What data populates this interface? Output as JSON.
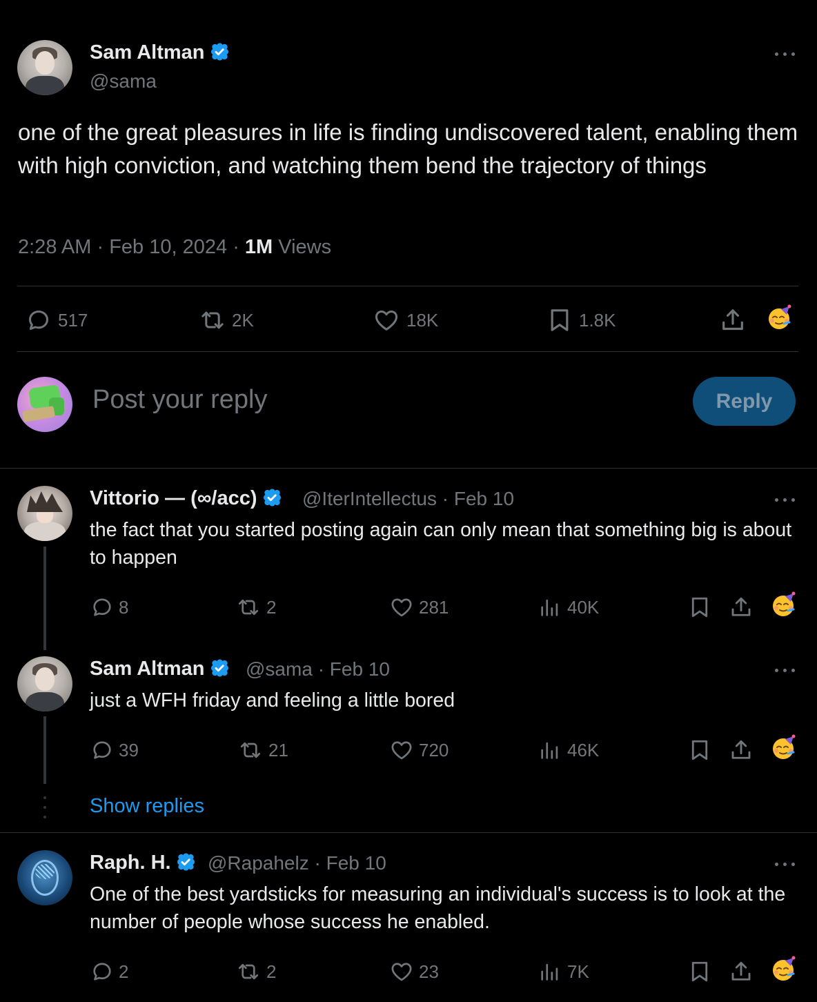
{
  "main_post": {
    "author_name": "Sam Altman",
    "author_handle": "@sama",
    "text": "one of the great pleasures in life is finding undiscovered talent, enabling them with high conviction, and watching them bend the trajectory of things",
    "time": "2:28 AM",
    "separator1": "·",
    "date": "Feb 10, 2024",
    "separator2": "·",
    "views_count": "1M",
    "views_label": "Views",
    "actions": {
      "replies": "517",
      "reposts": "2K",
      "likes": "18K",
      "bookmarks": "1.8K"
    }
  },
  "composer": {
    "placeholder": "Post your reply",
    "reply_button": "Reply"
  },
  "replies": [
    {
      "author_name": "Vittorio — (∞/acc)",
      "author_handle": "@IterIntellectus",
      "date": "· Feb 10",
      "text": "the fact that you started posting again can only mean that something big is about to happen",
      "actions": {
        "replies": "8",
        "reposts": "2",
        "likes": "281",
        "views": "40K"
      }
    },
    {
      "author_name": "Sam Altman",
      "author_handle": "@sama",
      "date": "· Feb 10",
      "text": "just a WFH friday and feeling a little bored",
      "actions": {
        "replies": "39",
        "reposts": "21",
        "likes": "720",
        "views": "46K"
      }
    },
    {
      "author_name": "Raph. H.",
      "author_handle": "@Rapahelz",
      "date": "· Feb 10",
      "text": "One of the best yardsticks for measuring an individual's success is to look at the number of people whose success he enabled.",
      "actions": {
        "replies": "2",
        "reposts": "2",
        "likes": "23",
        "views": "7K"
      }
    }
  ],
  "show_replies": "Show replies",
  "colors": {
    "background": "#000000",
    "text_primary": "#e7e9ea",
    "text_secondary": "#71767b",
    "accent": "#1d9bf0",
    "divider": "#2f3336"
  },
  "icons": [
    "verified-badge-icon",
    "more-icon",
    "reply-icon",
    "repost-icon",
    "like-icon",
    "bookmark-icon",
    "share-icon",
    "views-icon",
    "grok-emoji-icon"
  ]
}
